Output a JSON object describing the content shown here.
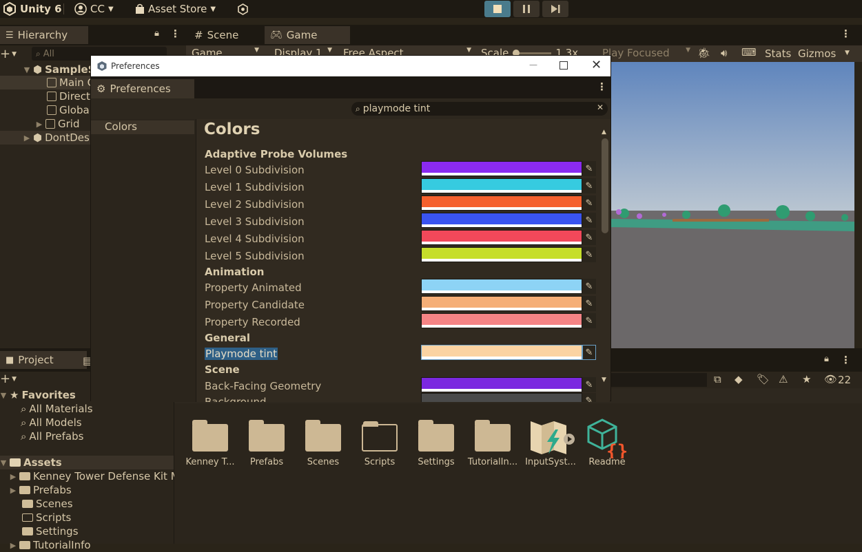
{
  "toolbar": {
    "app_title": "Unity 6",
    "account": "CC",
    "asset_store": "Asset Store"
  },
  "hierarchy": {
    "tab": "Hierarchy",
    "search_placeholder": "All",
    "items": [
      "SampleS",
      "Main C",
      "Direct",
      "Globa",
      "Grid",
      "DontDes"
    ]
  },
  "scene_tabs": {
    "scene": "Scene",
    "game": "Game"
  },
  "game_bar": {
    "game": "Game",
    "display": "Display 1",
    "aspect": "Free Aspect",
    "scale_label": "Scale",
    "scale_value": "1.3x",
    "play_focused": "Play Focused",
    "stats": "Stats",
    "gizmos": "Gizmos"
  },
  "dialog": {
    "window_title": "Preferences",
    "tab": "Preferences",
    "search_value": "playmode tint",
    "sidebar": [
      "Colors"
    ],
    "heading": "Colors",
    "sections": [
      {
        "title": "Adaptive Probe Volumes",
        "items": [
          {
            "label": "Level 0 Subdivision",
            "color": "#8a2af0"
          },
          {
            "label": "Level 1 Subdivision",
            "color": "#36cbe0"
          },
          {
            "label": "Level 2 Subdivision",
            "color": "#f5602d"
          },
          {
            "label": "Level 3 Subdivision",
            "color": "#3a54f0"
          },
          {
            "label": "Level 4 Subdivision",
            "color": "#f2485a"
          },
          {
            "label": "Level 5 Subdivision",
            "color": "#c6de2a"
          }
        ]
      },
      {
        "title": "Animation",
        "items": [
          {
            "label": "Property Animated",
            "color": "#8dd3f5"
          },
          {
            "label": "Property Candidate",
            "color": "#f5ae77"
          },
          {
            "label": "Property Recorded",
            "color": "#f58485"
          }
        ]
      },
      {
        "title": "General",
        "items": [
          {
            "label": "Playmode tint",
            "color": "#fbd3a2"
          }
        ]
      },
      {
        "title": "Scene",
        "items": [
          {
            "label": "Back-Facing Geometry",
            "color": "#7b28e0"
          },
          {
            "label": "Background",
            "color": "#4a4a4a"
          }
        ]
      }
    ]
  },
  "project": {
    "tab": "Project",
    "count": "22",
    "favorites_label": "Favorites",
    "favorites": [
      "All Materials",
      "All Models",
      "All Prefabs"
    ],
    "assets_label": "Assets",
    "assets": [
      "Kenney Tower Defense Kit M",
      "Prefabs",
      "Scenes",
      "Scripts",
      "Settings",
      "TutorialInfo"
    ],
    "grid": [
      "Kenney T...",
      "Prefabs",
      "Scenes",
      "Scripts",
      "Settings",
      "TutorialIn...",
      "InputSyst...",
      "Readme"
    ]
  }
}
